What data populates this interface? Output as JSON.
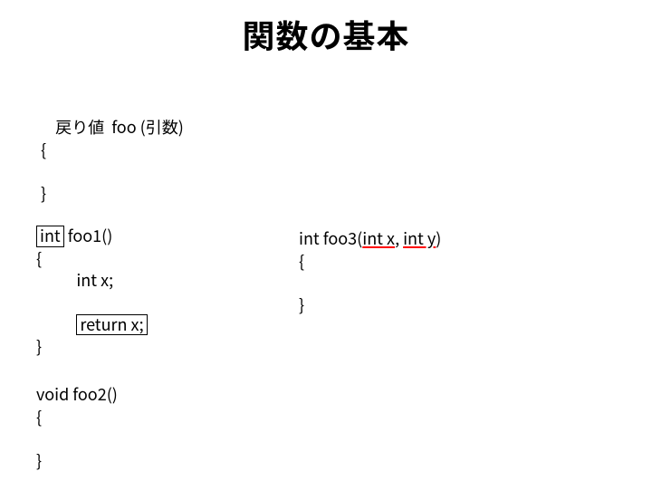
{
  "title": "関数の基本",
  "template": {
    "line1_pre": "戻り値",
    "line1_mid": "  foo (引数)",
    "line2": "{",
    "line3": "}"
  },
  "foo1": {
    "ret_boxed": "int",
    "sig_rest": " foo1()",
    "brace_open": "{",
    "decl_indent": "           ",
    "decl": "int x;",
    "ret_indent": "           ",
    "ret_boxed_stmt": "return x;",
    "brace_close": "}"
  },
  "foo3": {
    "sig_pre": "int foo3",
    "sig_args_open": "(",
    "arg1": "int x",
    "args_sep": ", ",
    "arg2": "int y",
    "sig_args_close": ")",
    "brace_open": "{",
    "brace_close": "}"
  },
  "foo2": {
    "sig": "void foo2()",
    "brace_open": "{",
    "brace_close": "}"
  }
}
